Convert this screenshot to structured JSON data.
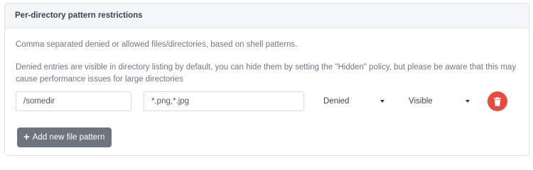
{
  "panel": {
    "title": "Per-directory pattern restrictions",
    "description_1": "Comma separated denied or allowed files/directories, based on shell patterns.",
    "description_2": "Denied entries are visible in directory listing by default, you can hide them by setting the \"Hidden\" policy, but please be aware that this may cause performance issues for large directories"
  },
  "pattern_row": {
    "path_value": "/somedir",
    "patterns_value": "*.png,*.jpg",
    "policy_selected": "Denied",
    "visibility_selected": "Visible",
    "delete_icon": "trash-icon",
    "delete_color": "#e74c3c"
  },
  "add_button": {
    "icon": "plus-icon",
    "label": "Add new file pattern"
  }
}
